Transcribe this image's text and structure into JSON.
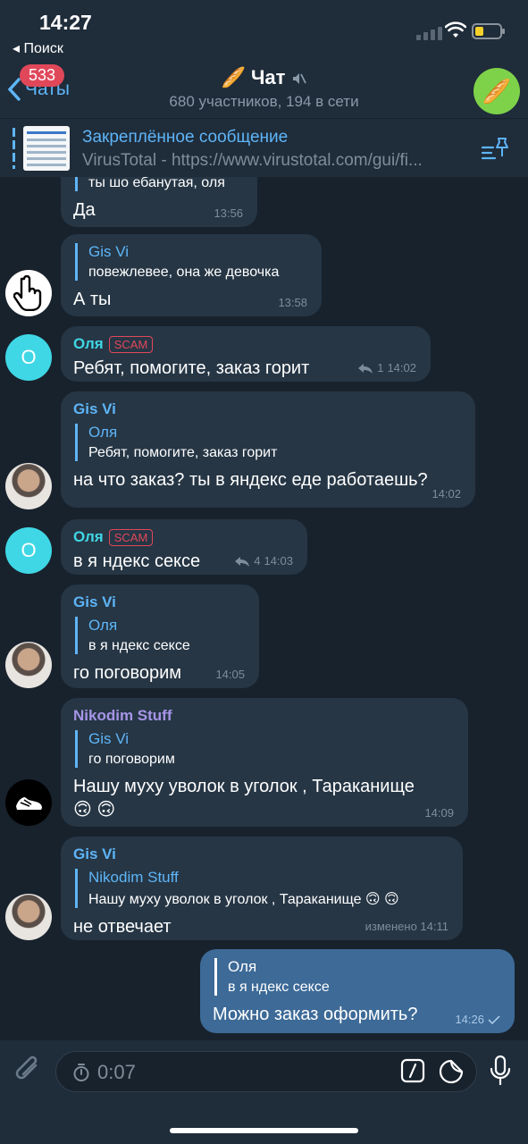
{
  "status": {
    "time": "14:27",
    "back_app": "◂ Поиск"
  },
  "header": {
    "back_label": "Чаты",
    "unread_badge": "533",
    "title": "🥖 Чат",
    "subtitle": "680 участников, 194 в сети",
    "avatar_emoji": "🥖"
  },
  "pinned": {
    "title": "Закреплённое сообщение",
    "text": "VirusTotal - https://www.virustotal.com/gui/fi..."
  },
  "messages": [
    {
      "partial_text": "ты шо ебанутая, оля",
      "text": "Да",
      "time": "13:56"
    },
    {
      "reply_name": "Gis Vi",
      "reply_text": "повежлевее, она же девочка",
      "text": "А ты",
      "time": "13:58"
    },
    {
      "sender": "Оля",
      "badge": "SCAM",
      "text": "Ребят, помогите, заказ горит",
      "replies": "1",
      "time": "14:02"
    },
    {
      "sender": "Gis Vi",
      "reply_name": "Оля",
      "reply_text": "Ребят, помогите, заказ горит",
      "text": "на что заказ? ты в яндекс еде работаешь?",
      "time": "14:02"
    },
    {
      "sender": "Оля",
      "badge": "SCAM",
      "text": "в я ндекс сексе",
      "replies": "4",
      "time": "14:03"
    },
    {
      "sender": "Gis Vi",
      "reply_name": "Оля",
      "reply_text": "в я ндекс сексе",
      "text": "го поговорим",
      "time": "14:05"
    },
    {
      "sender": "Nikodim Stuff",
      "reply_name": "Gis Vi",
      "reply_text": "го поговорим",
      "text": "Нашу муху уволок в уголок , Тараканище",
      "emoji": "🙃 🙃",
      "time": "14:09"
    },
    {
      "sender": "Gis Vi",
      "reply_name": "Nikodim Stuff",
      "reply_text": "Нашу муху уволок в уголок , Тараканище 🙃 🙃",
      "text": "не отвечает",
      "time": "изменено 14:11"
    },
    {
      "reply_name": "Оля",
      "reply_text": "в я ндекс сексе",
      "text": "Можно заказ оформить?",
      "time": "14:26"
    }
  ],
  "avatars": {
    "olya_letter": "О"
  },
  "input": {
    "timer": "0:07"
  },
  "colors": {
    "accent": "#5eb5f7",
    "scam": "#e0485a",
    "olya_name": "#3fd7e5",
    "gisvi_name": "#5eb5f7",
    "nikodim_name": "#a695e7"
  }
}
